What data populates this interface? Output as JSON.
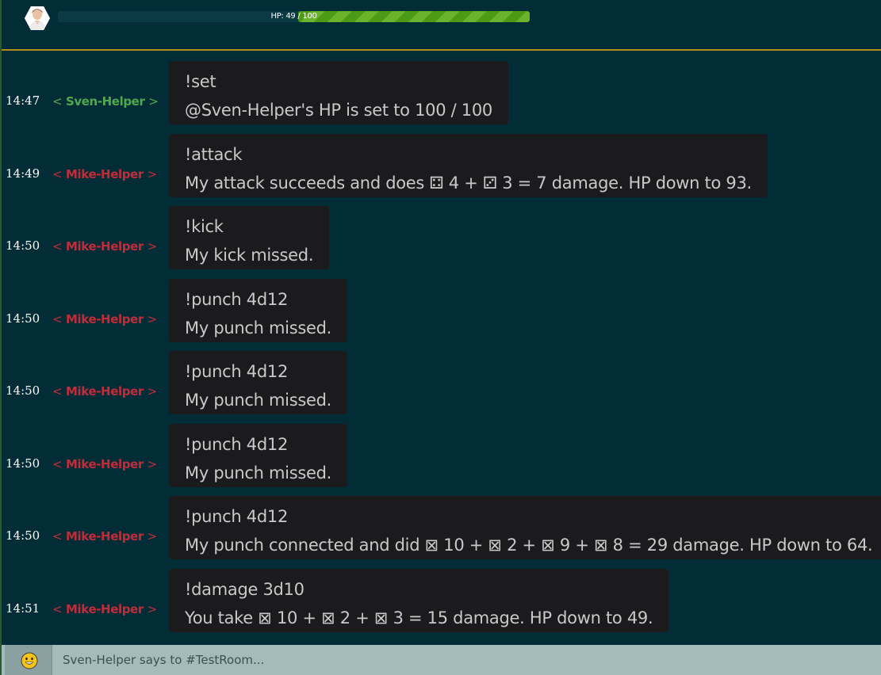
{
  "header": {
    "avatar": "user-avatar",
    "hp": {
      "label": "HP: 49 / 100",
      "current": 49,
      "max": 100
    }
  },
  "messages": [
    {
      "time": "14:47",
      "nick": "Sven-Helper",
      "nick_color": "#4ea84e",
      "command": "!set",
      "response": "@Sven-Helper's HP is set to 100 / 100"
    },
    {
      "time": "14:49",
      "nick": "Mike-Helper",
      "nick_color": "#c02c3a",
      "command": "!attack",
      "response": "My attack succeeds and does ⚃ 4 + ⚂ 3 = 7 damage. HP down to 93."
    },
    {
      "time": "14:50",
      "nick": "Mike-Helper",
      "nick_color": "#c02c3a",
      "command": "!kick",
      "response": "My kick missed."
    },
    {
      "time": "14:50",
      "nick": "Mike-Helper",
      "nick_color": "#c02c3a",
      "command": "!punch 4d12",
      "response": "My punch missed."
    },
    {
      "time": "14:50",
      "nick": "Mike-Helper",
      "nick_color": "#c02c3a",
      "command": "!punch 4d12",
      "response": "My punch missed."
    },
    {
      "time": "14:50",
      "nick": "Mike-Helper",
      "nick_color": "#c02c3a",
      "command": "!punch 4d12",
      "response": "My punch missed."
    },
    {
      "time": "14:50",
      "nick": "Mike-Helper",
      "nick_color": "#c02c3a",
      "command": "!punch 4d12",
      "response": "My punch connected and did ⊠ 10 + ⊠ 2 + ⊠ 9 + ⊠ 8 = 29 damage. HP down to 64."
    },
    {
      "time": "14:51",
      "nick": "Mike-Helper",
      "nick_color": "#c02c3a",
      "command": "!damage 3d10",
      "response": "You take ⊠ 10 + ⊠ 2 + ⊠ 3 = 15 damage. HP down to 49."
    }
  ],
  "nick_brackets": {
    "open": "<",
    "close": ">"
  },
  "input": {
    "placeholder": "Sven-Helper says to #TestRoom...",
    "value": "",
    "emoji_icon": "smiley-emoji-icon"
  },
  "colors": {
    "background": "#032d36",
    "bubble": "#1b1a1d",
    "header_border": "#b48a1c",
    "hp_fill": "#4d9a17",
    "input_bar": "#a4bbbb"
  }
}
